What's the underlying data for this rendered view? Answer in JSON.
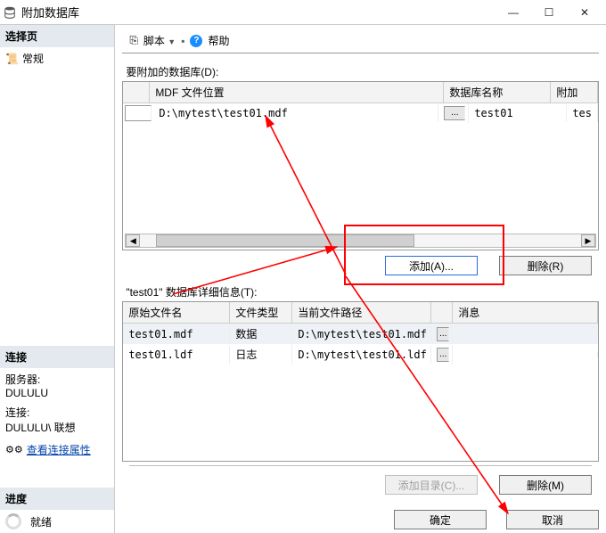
{
  "window": {
    "title": "附加数据库",
    "min": "—",
    "max": "☐",
    "close": "✕"
  },
  "left": {
    "select_page_hdr": "选择页",
    "general_item": "常规",
    "connection_hdr": "连接",
    "server_label": "服务器:",
    "server_value": "DULULU",
    "conn_label": "连接:",
    "conn_value": "DULULU\\ 联想",
    "view_conn_link": "查看连接属性",
    "progress_hdr": "进度",
    "progress_status": "就绪"
  },
  "toolbar": {
    "script_label": "脚本",
    "help_label": "帮助"
  },
  "upper": {
    "label": "要附加的数据库(D):",
    "col_location": "MDF 文件位置",
    "col_dbname": "数据库名称",
    "col_attach": "附加",
    "row_location": "D:\\mytest\\test01.mdf",
    "row_dbname": "test01",
    "row_attach": "tes",
    "browse_label": "...",
    "add_btn": "添加(A)...",
    "remove_btn": "删除(R)"
  },
  "lower": {
    "label": "\"test01\" 数据库详细信息(T):",
    "col_file": "原始文件名",
    "col_type": "文件类型",
    "col_path": "当前文件路径",
    "col_msg": "消息",
    "rows": [
      {
        "file": "test01.mdf",
        "type": "数据",
        "path": "D:\\mytest\\test01.mdf",
        "msg": ""
      },
      {
        "file": "test01.ldf",
        "type": "日志",
        "path": "D:\\mytest\\test01.ldf",
        "msg": ""
      }
    ],
    "browse_label": "...",
    "add_dir_btn": "添加目录(C)...",
    "remove_btn": "删除(M)"
  },
  "footer": {
    "ok": "确定",
    "cancel": "取消"
  }
}
